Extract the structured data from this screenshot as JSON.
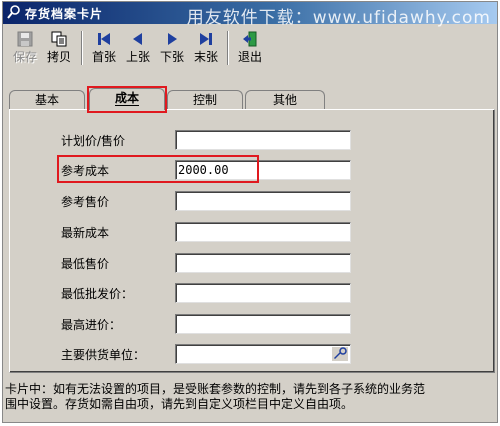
{
  "window": {
    "title": "存货档案卡片",
    "watermark": "用友软件下载：www.ufidawhy.com"
  },
  "toolbar": {
    "buttons": [
      {
        "label": "保存",
        "icon": "save-icon",
        "enabled": false
      },
      {
        "label": "拷贝",
        "icon": "copy-icon",
        "enabled": true
      },
      {
        "label": "首张",
        "icon": "first-record-icon",
        "enabled": true
      },
      {
        "label": "上张",
        "icon": "previous-record-icon",
        "enabled": true
      },
      {
        "label": "下张",
        "icon": "next-record-icon",
        "enabled": true
      },
      {
        "label": "末张",
        "icon": "last-record-icon",
        "enabled": true
      },
      {
        "label": "退出",
        "icon": "exit-icon",
        "enabled": true
      }
    ]
  },
  "tabs": [
    {
      "label": "基本",
      "active": false
    },
    {
      "label": "成本",
      "active": true
    },
    {
      "label": "控制",
      "active": false
    },
    {
      "label": "其他",
      "active": false
    }
  ],
  "form": {
    "fields": [
      {
        "label": "计划价/售价",
        "value": ""
      },
      {
        "label": "参考成本",
        "value": "2000.00"
      },
      {
        "label": "参考售价",
        "value": ""
      },
      {
        "label": "最新成本",
        "value": ""
      },
      {
        "label": "最低售价",
        "value": ""
      },
      {
        "label": "最低批发价：",
        "value": ""
      },
      {
        "label": "最高进价：",
        "value": ""
      },
      {
        "label": "主要供货单位：",
        "value": "",
        "has_reference_button": true
      }
    ]
  },
  "status": {
    "line1": "卡片中：如有无法设置的项目，是受账套参数的控制，请先到各子系统的业务范",
    "line2": "围中设置。存货如需自由项，请先到自定义项栏目中定义自由项。"
  },
  "colors": {
    "title_bar_start": "#0a246a",
    "title_bar_end": "#a6caf0",
    "window_face": "#d4d0c8",
    "highlight_box": "#e0191f",
    "nav_icon_blue": "#1f3f9f"
  }
}
